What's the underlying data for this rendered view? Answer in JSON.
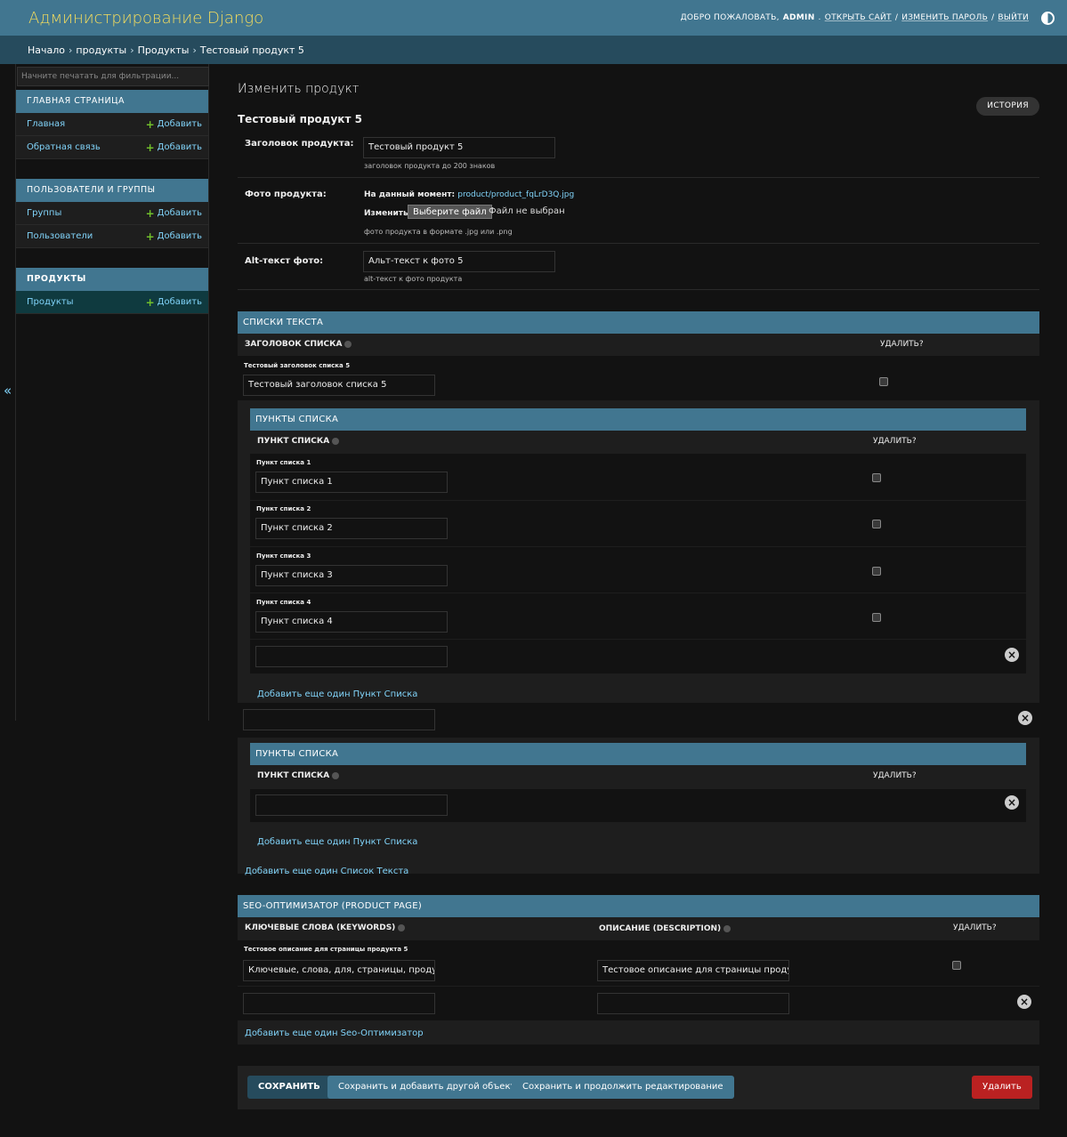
{
  "header": {
    "branding": "Администрирование Django",
    "welcome": "Добро пожаловать,",
    "username": "ADMIN",
    "view_site": "Открыть сайт",
    "change_password": "Изменить пароль",
    "logout": "Выйти",
    "sep": "/",
    "sep_dot": "."
  },
  "breadcrumbs": {
    "home": "Начало",
    "app": "продукты",
    "model": "Продукты",
    "current": "Тестовый продукт 5",
    "sep": "›"
  },
  "sidebar": {
    "filter_placeholder": "Начните печатать для фильтрации...",
    "add_label": "Добавить",
    "modules": [
      {
        "caption": "Главная страница",
        "rows": [
          "Главная",
          "Обратная связь"
        ]
      },
      {
        "caption": "Пользователи и группы",
        "rows": [
          "Группы",
          "Пользователи"
        ]
      },
      {
        "caption": "Продукты",
        "rows": [
          "Продукты"
        ]
      }
    ],
    "toggle": "«"
  },
  "content": {
    "title": "Изменить продукт",
    "object_name": "Тестовый продукт 5",
    "history": "История",
    "fields": {
      "title_label": "Заголовок продукта:",
      "title_value": "Тестовый продукт 5",
      "title_help": "заголовок продукта до 200 знаков",
      "photo_label": "Фото продукта:",
      "photo_current_label": "На данный момент:",
      "photo_current_link": "product/product_fqLrD3Q.jpg",
      "photo_change_label": "Изменить:",
      "photo_button": "Выберите файл",
      "photo_none": "Файл не выбран",
      "photo_help": "фото продукта в формате .jpg или .png",
      "alt_label": "Alt-текст фото:",
      "alt_value": "Альт-текст к фото 5",
      "alt_help": "alt-текст к фото продукта"
    },
    "text_lists": {
      "heading": "Списки текста",
      "col_title": "Заголовок списка",
      "col_delete": "Удалить?",
      "row_original": "Тестовый заголовок списка 5",
      "row_value": "Тестовый заголовок списка 5",
      "add_link": "Добавить еще один Список Текста"
    },
    "list_items": {
      "heading": "Пункты списка",
      "col_item": "Пункт списка",
      "col_delete": "Удалить?",
      "rows": [
        {
          "original": "Пункт списка 1",
          "value": "Пункт списка 1"
        },
        {
          "original": "Пункт списка 2",
          "value": "Пункт списка 2"
        },
        {
          "original": "Пункт списка 3",
          "value": "Пункт списка 3"
        },
        {
          "original": "Пункт списка 4",
          "value": "Пункт списка 4"
        }
      ],
      "add_link": "Добавить еще один Пункт Списка"
    },
    "seo": {
      "heading": "SEO-оптимизатор (PRODUCT PAGE)",
      "col_keywords": "Ключевые слова (keywords)",
      "col_description": "Описание (description)",
      "col_delete": "Удалить?",
      "row_original": "Тестовое описание для страницы продукта 5",
      "keywords_value": "Ключевые, слова, для, страницы, продукта,",
      "description_value": "Тестовое описание для страницы продукта",
      "add_link": "Добавить еще один Seo-Оптимизатор"
    },
    "submit": {
      "save": "Сохранить",
      "save_add": "Сохранить и добавить другой объект",
      "save_continue": "Сохранить и продолжить редактирование",
      "delete": "Удалить"
    },
    "delete_icon": "×"
  },
  "colors": {
    "header": "#417690",
    "breadcrumbs": "#264b5d",
    "branding": "#f5dd5d",
    "link": "#81d4fa",
    "danger": "#ba2121",
    "add_plus": "#70bf2b"
  }
}
